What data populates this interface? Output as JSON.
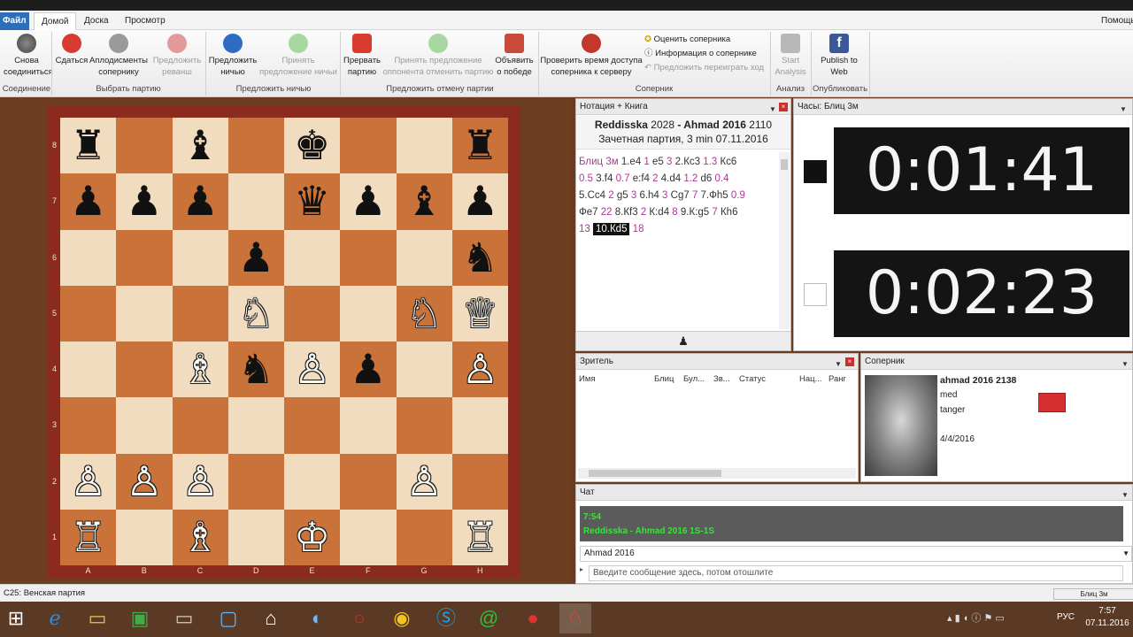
{
  "menu": {
    "file": "Файл",
    "tabs": [
      "Домой",
      "Доска",
      "Просмотр"
    ],
    "help": "Помощь"
  },
  "ribbon": {
    "reconnect": "Снова соединиться",
    "resign": "Сдаться",
    "applaud": "Аплодисменты сопернику",
    "rematch": "Предложить реванш",
    "offer_draw": "Предложить ничью",
    "accept_draw": "Принять предложение ничьи",
    "abort": "Прервать партию",
    "accept_abort": "Принять предложение оппонента отменить партию",
    "claim_win": "Объявить о победе",
    "check_time": "Проверить время доступа соперника к серверу",
    "rate_opp": "Оценить соперника",
    "info_opp": "Информация о сопернике",
    "offer_replay": "Предложить переиграть ход",
    "start_analysis": "Start Analysis",
    "publish": "Publish to Web",
    "groups": [
      "Соединение",
      "Выбрать партию",
      "Предложить ничью",
      "Предложить отмену партии",
      "Соперник",
      "Анализ",
      "Опубликовать"
    ]
  },
  "notation": {
    "panel": "Нотация + Книга",
    "white": "Reddisska",
    "white_elo": "2028",
    "sep": " - ",
    "black": "Ahmad 2016",
    "black_elo": "2110",
    "subtitle": "Зачетная партия, 3 min 07.11.2016",
    "lines": [
      [
        [
          "Блиц 3м",
          "t"
        ],
        [
          " 1.e4 ",
          "m"
        ],
        [
          "1",
          "t"
        ],
        [
          " e5 ",
          "m"
        ],
        [
          "3",
          "t"
        ],
        [
          " 2.Кс3 ",
          "m"
        ],
        [
          "1.3",
          "t"
        ],
        [
          " Кс6",
          "m"
        ]
      ],
      [
        [
          "0.5",
          "t"
        ],
        [
          " 3.f4 ",
          "m"
        ],
        [
          "0.7",
          "t"
        ],
        [
          " e:f4 ",
          "m"
        ],
        [
          "2",
          "t"
        ],
        [
          " 4.d4 ",
          "m"
        ],
        [
          "1.2",
          "t"
        ],
        [
          " d6 ",
          "m"
        ],
        [
          "0.4",
          "t"
        ]
      ],
      [
        [
          "5.Сс4 ",
          "m"
        ],
        [
          "2",
          "t"
        ],
        [
          " g5 ",
          "m"
        ],
        [
          "3",
          "t"
        ],
        [
          " 6.h4 ",
          "m"
        ],
        [
          "3",
          "t"
        ],
        [
          " Сg7 ",
          "m"
        ],
        [
          "7",
          "t"
        ],
        [
          " 7.Фh5 ",
          "m"
        ],
        [
          "0.9",
          "t"
        ]
      ],
      [
        [
          "Фе7 ",
          "m"
        ],
        [
          "22",
          "t"
        ],
        [
          " 8.Кf3 ",
          "m"
        ],
        [
          "2",
          "t"
        ],
        [
          " К:d4 ",
          "m"
        ],
        [
          "8",
          "t"
        ],
        [
          " 9.К:g5 ",
          "m"
        ],
        [
          "7",
          "t"
        ],
        [
          " Кh6",
          "m"
        ]
      ],
      [
        [
          "13 ",
          "t"
        ],
        [
          "10.Кd5",
          "h"
        ],
        [
          " 18",
          "t"
        ]
      ]
    ]
  },
  "clock": {
    "panel": "Часы: Блиц 3м",
    "top": "0:01:41",
    "bottom": "0:02:23"
  },
  "spectator": {
    "panel": "Зритель",
    "cols": [
      "Имя",
      "Блиц",
      "Бул...",
      "Зв...",
      "Статус",
      "Нац...",
      "Ранг"
    ]
  },
  "opponent": {
    "panel": "Соперник",
    "name": "ahmad 2016 2138",
    "line2": "med",
    "line3": "tanger",
    "date": "4/4/2016"
  },
  "chat": {
    "panel": "Чат",
    "time": "7:54",
    "msg": "Reddisska - Ahmad 2016 1S-1S",
    "select": "Ahmad 2016",
    "placeholder": "Введите сообщение здесь, потом отошлите"
  },
  "status": {
    "opening": "C25: Венская партия",
    "right": "Блиц 3м"
  },
  "taskbar": {
    "lang": "РУС",
    "time": "7:57",
    "date": "07.11.2016"
  },
  "board": {
    "files": [
      "A",
      "B",
      "C",
      "D",
      "E",
      "F",
      "G",
      "H"
    ],
    "ranks": [
      "8",
      "7",
      "6",
      "5",
      "4",
      "3",
      "2",
      "1"
    ],
    "pieces": [
      {
        "sq": "a8",
        "g": "♜",
        "c": "b"
      },
      {
        "sq": "c8",
        "g": "♝",
        "c": "b"
      },
      {
        "sq": "e8",
        "g": "♚",
        "c": "b"
      },
      {
        "sq": "h8",
        "g": "♜",
        "c": "b"
      },
      {
        "sq": "a7",
        "g": "♟",
        "c": "b"
      },
      {
        "sq": "b7",
        "g": "♟",
        "c": "b"
      },
      {
        "sq": "c7",
        "g": "♟",
        "c": "b"
      },
      {
        "sq": "e7",
        "g": "♛",
        "c": "b"
      },
      {
        "sq": "f7",
        "g": "♟",
        "c": "b"
      },
      {
        "sq": "g7",
        "g": "♝",
        "c": "b"
      },
      {
        "sq": "h7",
        "g": "♟",
        "c": "b"
      },
      {
        "sq": "d6",
        "g": "♟",
        "c": "b"
      },
      {
        "sq": "h6",
        "g": "♞",
        "c": "b"
      },
      {
        "sq": "d5",
        "g": "♘",
        "c": "w"
      },
      {
        "sq": "g5",
        "g": "♘",
        "c": "w"
      },
      {
        "sq": "h5",
        "g": "♕",
        "c": "w"
      },
      {
        "sq": "c4",
        "g": "♗",
        "c": "w"
      },
      {
        "sq": "d4",
        "g": "♞",
        "c": "b"
      },
      {
        "sq": "e4",
        "g": "♙",
        "c": "w"
      },
      {
        "sq": "f4",
        "g": "♟",
        "c": "b"
      },
      {
        "sq": "h4",
        "g": "♙",
        "c": "w"
      },
      {
        "sq": "a2",
        "g": "♙",
        "c": "w"
      },
      {
        "sq": "b2",
        "g": "♙",
        "c": "w"
      },
      {
        "sq": "c2",
        "g": "♙",
        "c": "w"
      },
      {
        "sq": "g2",
        "g": "♙",
        "c": "w"
      },
      {
        "sq": "a1",
        "g": "♖",
        "c": "w"
      },
      {
        "sq": "c1",
        "g": "♗",
        "c": "w"
      },
      {
        "sq": "e1",
        "g": "♔",
        "c": "w"
      },
      {
        "sq": "h1",
        "g": "♖",
        "c": "w"
      }
    ]
  }
}
